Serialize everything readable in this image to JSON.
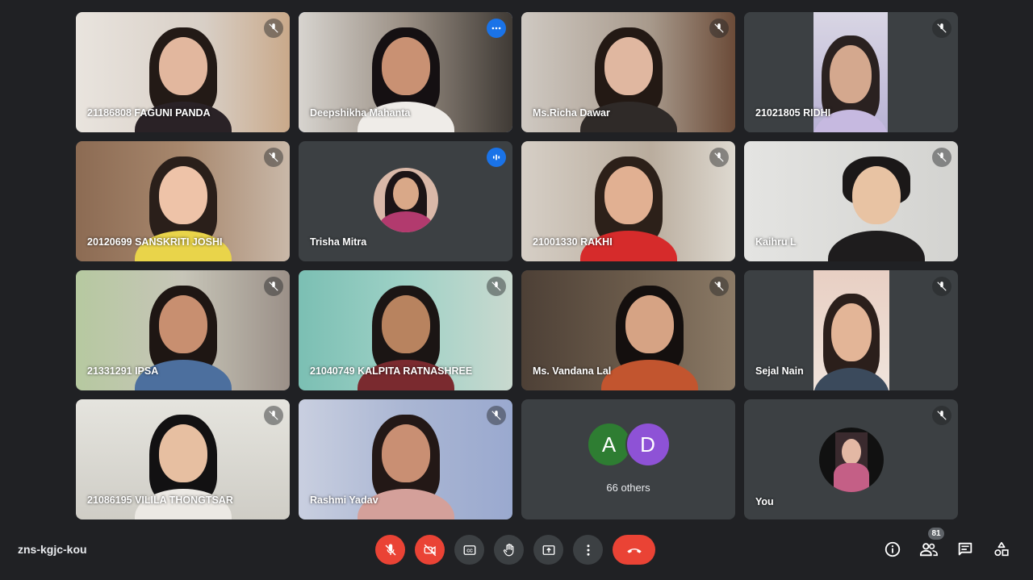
{
  "meeting": {
    "code": "zns-kgjc-kou",
    "participants_count": "81"
  },
  "tiles": [
    {
      "name": "21186808 FAGUNI PANDA",
      "muted": true
    },
    {
      "name": "Deepshikha Mahanta",
      "active": true,
      "more_options": true
    },
    {
      "name": "Ms.Richa Dawar",
      "muted": true
    },
    {
      "name": "21021805 RIDHI",
      "muted": true
    },
    {
      "name": "20120699 SANSKRITI JOSHI",
      "muted": true
    },
    {
      "name": "Trisha Mitra",
      "speaking": true
    },
    {
      "name": "21001330 RAKHI",
      "muted": true
    },
    {
      "name": "Kaihru L",
      "muted": true
    },
    {
      "name": "21331291 IPSA",
      "muted": true
    },
    {
      "name": "21040749 KALPITA RATNASHREE",
      "muted": true
    },
    {
      "name": "Ms. Vandana Lal",
      "muted": true
    },
    {
      "name": "Sejal Nain",
      "muted": true
    },
    {
      "name": "21086195 VILILA THONGTSAR",
      "muted": true
    },
    {
      "name": "Rashmi Yadav",
      "muted": true
    },
    {
      "others_label": "66 others",
      "initials": [
        "A",
        "D"
      ],
      "initial_colors": [
        "#2e7d32",
        "#8e52d6"
      ]
    },
    {
      "name": "You",
      "muted": true
    }
  ],
  "controls": [
    "mic-off",
    "camera-off",
    "captions",
    "raise-hand",
    "present",
    "more-options",
    "end-call"
  ],
  "right_icons": [
    "info-icon",
    "people-icon",
    "chat-icon",
    "activities-icon"
  ],
  "colors": {
    "background": "#202124",
    "tile": "#3c4043",
    "danger": "#ea4335",
    "accent": "#1a73e8"
  }
}
